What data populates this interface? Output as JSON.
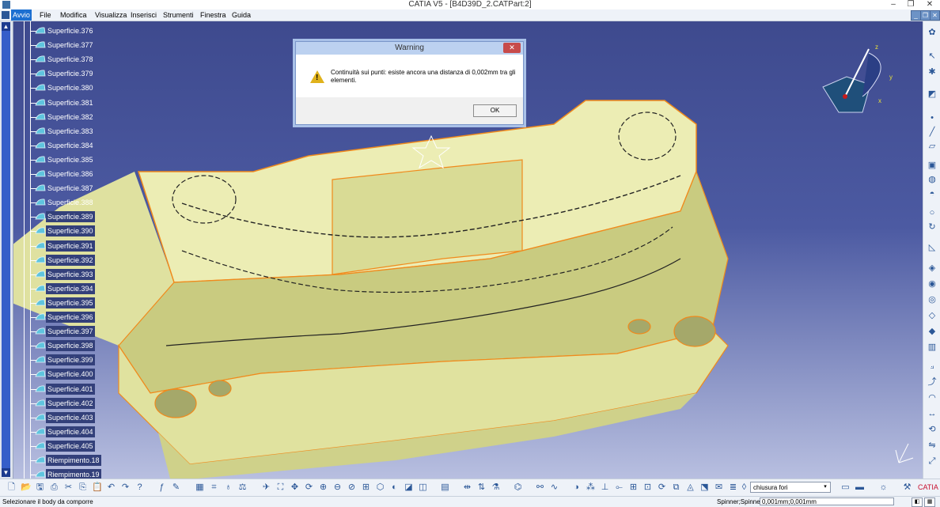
{
  "window": {
    "title": "CATIA V5 - [B4D39D_2.CATPart:2]",
    "minimize": "–",
    "restore": "❐",
    "close": "✕"
  },
  "mdi": {
    "minimize": "_",
    "restore": "❐",
    "close": "✕"
  },
  "menu": [
    {
      "label": "Avvio",
      "active": true
    },
    {
      "label": "File"
    },
    {
      "label": "Modifica"
    },
    {
      "label": "Visualizza"
    },
    {
      "label": "Inserisci"
    },
    {
      "label": "Strumenti"
    },
    {
      "label": "Finestra"
    },
    {
      "label": "Guida"
    }
  ],
  "tree": {
    "items": [
      {
        "label": "Superficie.376",
        "selected": false
      },
      {
        "label": "Superficie.377",
        "selected": false
      },
      {
        "label": "Superficie.378",
        "selected": false
      },
      {
        "label": "Superficie.379",
        "selected": false
      },
      {
        "label": "Superficie.380",
        "selected": false
      },
      {
        "label": "Superficie.381",
        "selected": false
      },
      {
        "label": "Superficie.382",
        "selected": false
      },
      {
        "label": "Superficie.383",
        "selected": false
      },
      {
        "label": "Superficie.384",
        "selected": false
      },
      {
        "label": "Superficie.385",
        "selected": false
      },
      {
        "label": "Superficie.386",
        "selected": false
      },
      {
        "label": "Superficie.387",
        "selected": false
      },
      {
        "label": "Superficie.388",
        "selected": false
      },
      {
        "label": "Superficie.389",
        "selected": true
      },
      {
        "label": "Superficie.390",
        "selected": true
      },
      {
        "label": "Superficie.391",
        "selected": true
      },
      {
        "label": "Superficie.392",
        "selected": true
      },
      {
        "label": "Superficie.393",
        "selected": true
      },
      {
        "label": "Superficie.394",
        "selected": true
      },
      {
        "label": "Superficie.395",
        "selected": true
      },
      {
        "label": "Superficie.396",
        "selected": true
      },
      {
        "label": "Superficie.397",
        "selected": true
      },
      {
        "label": "Superficie.398",
        "selected": true
      },
      {
        "label": "Superficie.399",
        "selected": true
      },
      {
        "label": "Superficie.400",
        "selected": true
      },
      {
        "label": "Superficie.401",
        "selected": true
      },
      {
        "label": "Superficie.402",
        "selected": true
      },
      {
        "label": "Superficie.403",
        "selected": true
      },
      {
        "label": "Superficie.404",
        "selected": true
      },
      {
        "label": "Superficie.405",
        "selected": true
      },
      {
        "label": "Riempimento.18",
        "selected": true
      },
      {
        "label": "Riempimento.19",
        "selected": true
      }
    ]
  },
  "compass": {
    "x_label": "x",
    "y_label": "y",
    "z_label": "z"
  },
  "dialog": {
    "title": "Warning",
    "close": "✕",
    "message": "Continuità sui punti: esiste ancora una distanza di 0,002mm tra gli elementi.",
    "ok_label": "OK",
    "icon": "warning-icon"
  },
  "toolbar": {
    "selected_command": "chiusura fori",
    "select_arrow": "▾"
  },
  "status": {
    "left_text": "Selezionare il body da comporre",
    "spinner_label": "Spinner;Spinner",
    "spinner_value": "0,001mm;0,001mm"
  },
  "colors": {
    "viewport_top": "#3e4a8e",
    "part_fill": "#e8e9a6",
    "edge_orange": "#f08a1c",
    "selection": "#33407a"
  }
}
